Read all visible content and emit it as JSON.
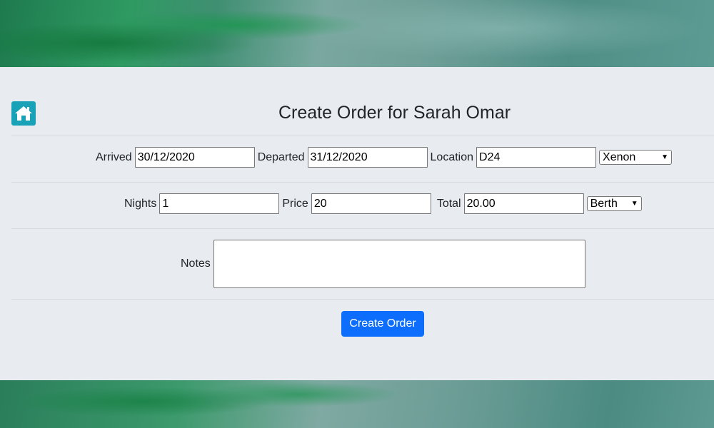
{
  "page": {
    "title": "Create Order for Sarah Omar"
  },
  "nav": {
    "home_icon": "home-icon"
  },
  "form": {
    "arrived": {
      "label": "Arrived",
      "value": "30/12/2020"
    },
    "departed": {
      "label": "Departed",
      "value": "31/12/2020"
    },
    "location": {
      "label": "Location",
      "value": "D24"
    },
    "location_select": {
      "selected": "Xenon"
    },
    "nights": {
      "label": "Nights",
      "value": "1"
    },
    "price": {
      "label": "Price",
      "value": "20"
    },
    "total": {
      "label": "Total",
      "value": "20.00"
    },
    "type_select": {
      "selected": "Berth"
    },
    "notes": {
      "label": "Notes",
      "value": ""
    },
    "submit_label": "Create Order"
  },
  "colors": {
    "panel_bg": "#e8ebef",
    "home_button": "#17a2b8",
    "primary_button": "#0d6efd"
  }
}
